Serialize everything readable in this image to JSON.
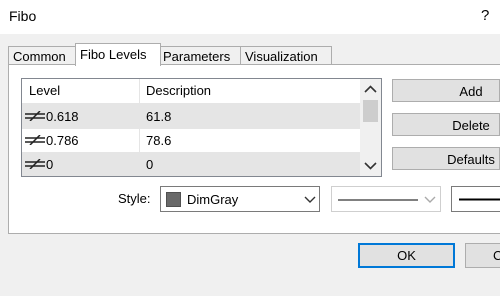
{
  "window": {
    "title": "Fibo",
    "help_label": "?"
  },
  "tabs": [
    {
      "label": "Common",
      "active": false
    },
    {
      "label": "Fibo Levels",
      "active": true
    },
    {
      "label": "Parameters",
      "active": false
    },
    {
      "label": "Visualization",
      "active": false
    }
  ],
  "levels_table": {
    "columns": [
      "Level",
      "Description"
    ],
    "rows": [
      {
        "level": "0.618",
        "description": "61.8",
        "selected": true
      },
      {
        "level": "0.786",
        "description": "78.6",
        "selected": false
      },
      {
        "level": "0",
        "description": "0",
        "selected": true
      }
    ]
  },
  "actions": {
    "add": "Add",
    "delete": "Delete",
    "defaults": "Defaults"
  },
  "style": {
    "label": "Style:",
    "color_name": "DimGray",
    "color_hex": "#696969"
  },
  "footer": {
    "ok": "OK",
    "cancel_partial": "C"
  },
  "icons": {
    "level": "level-line-icon",
    "scroll_up": "chevron-up-icon",
    "scroll_down": "chevron-down-icon",
    "dropdown": "chevron-down-icon"
  }
}
